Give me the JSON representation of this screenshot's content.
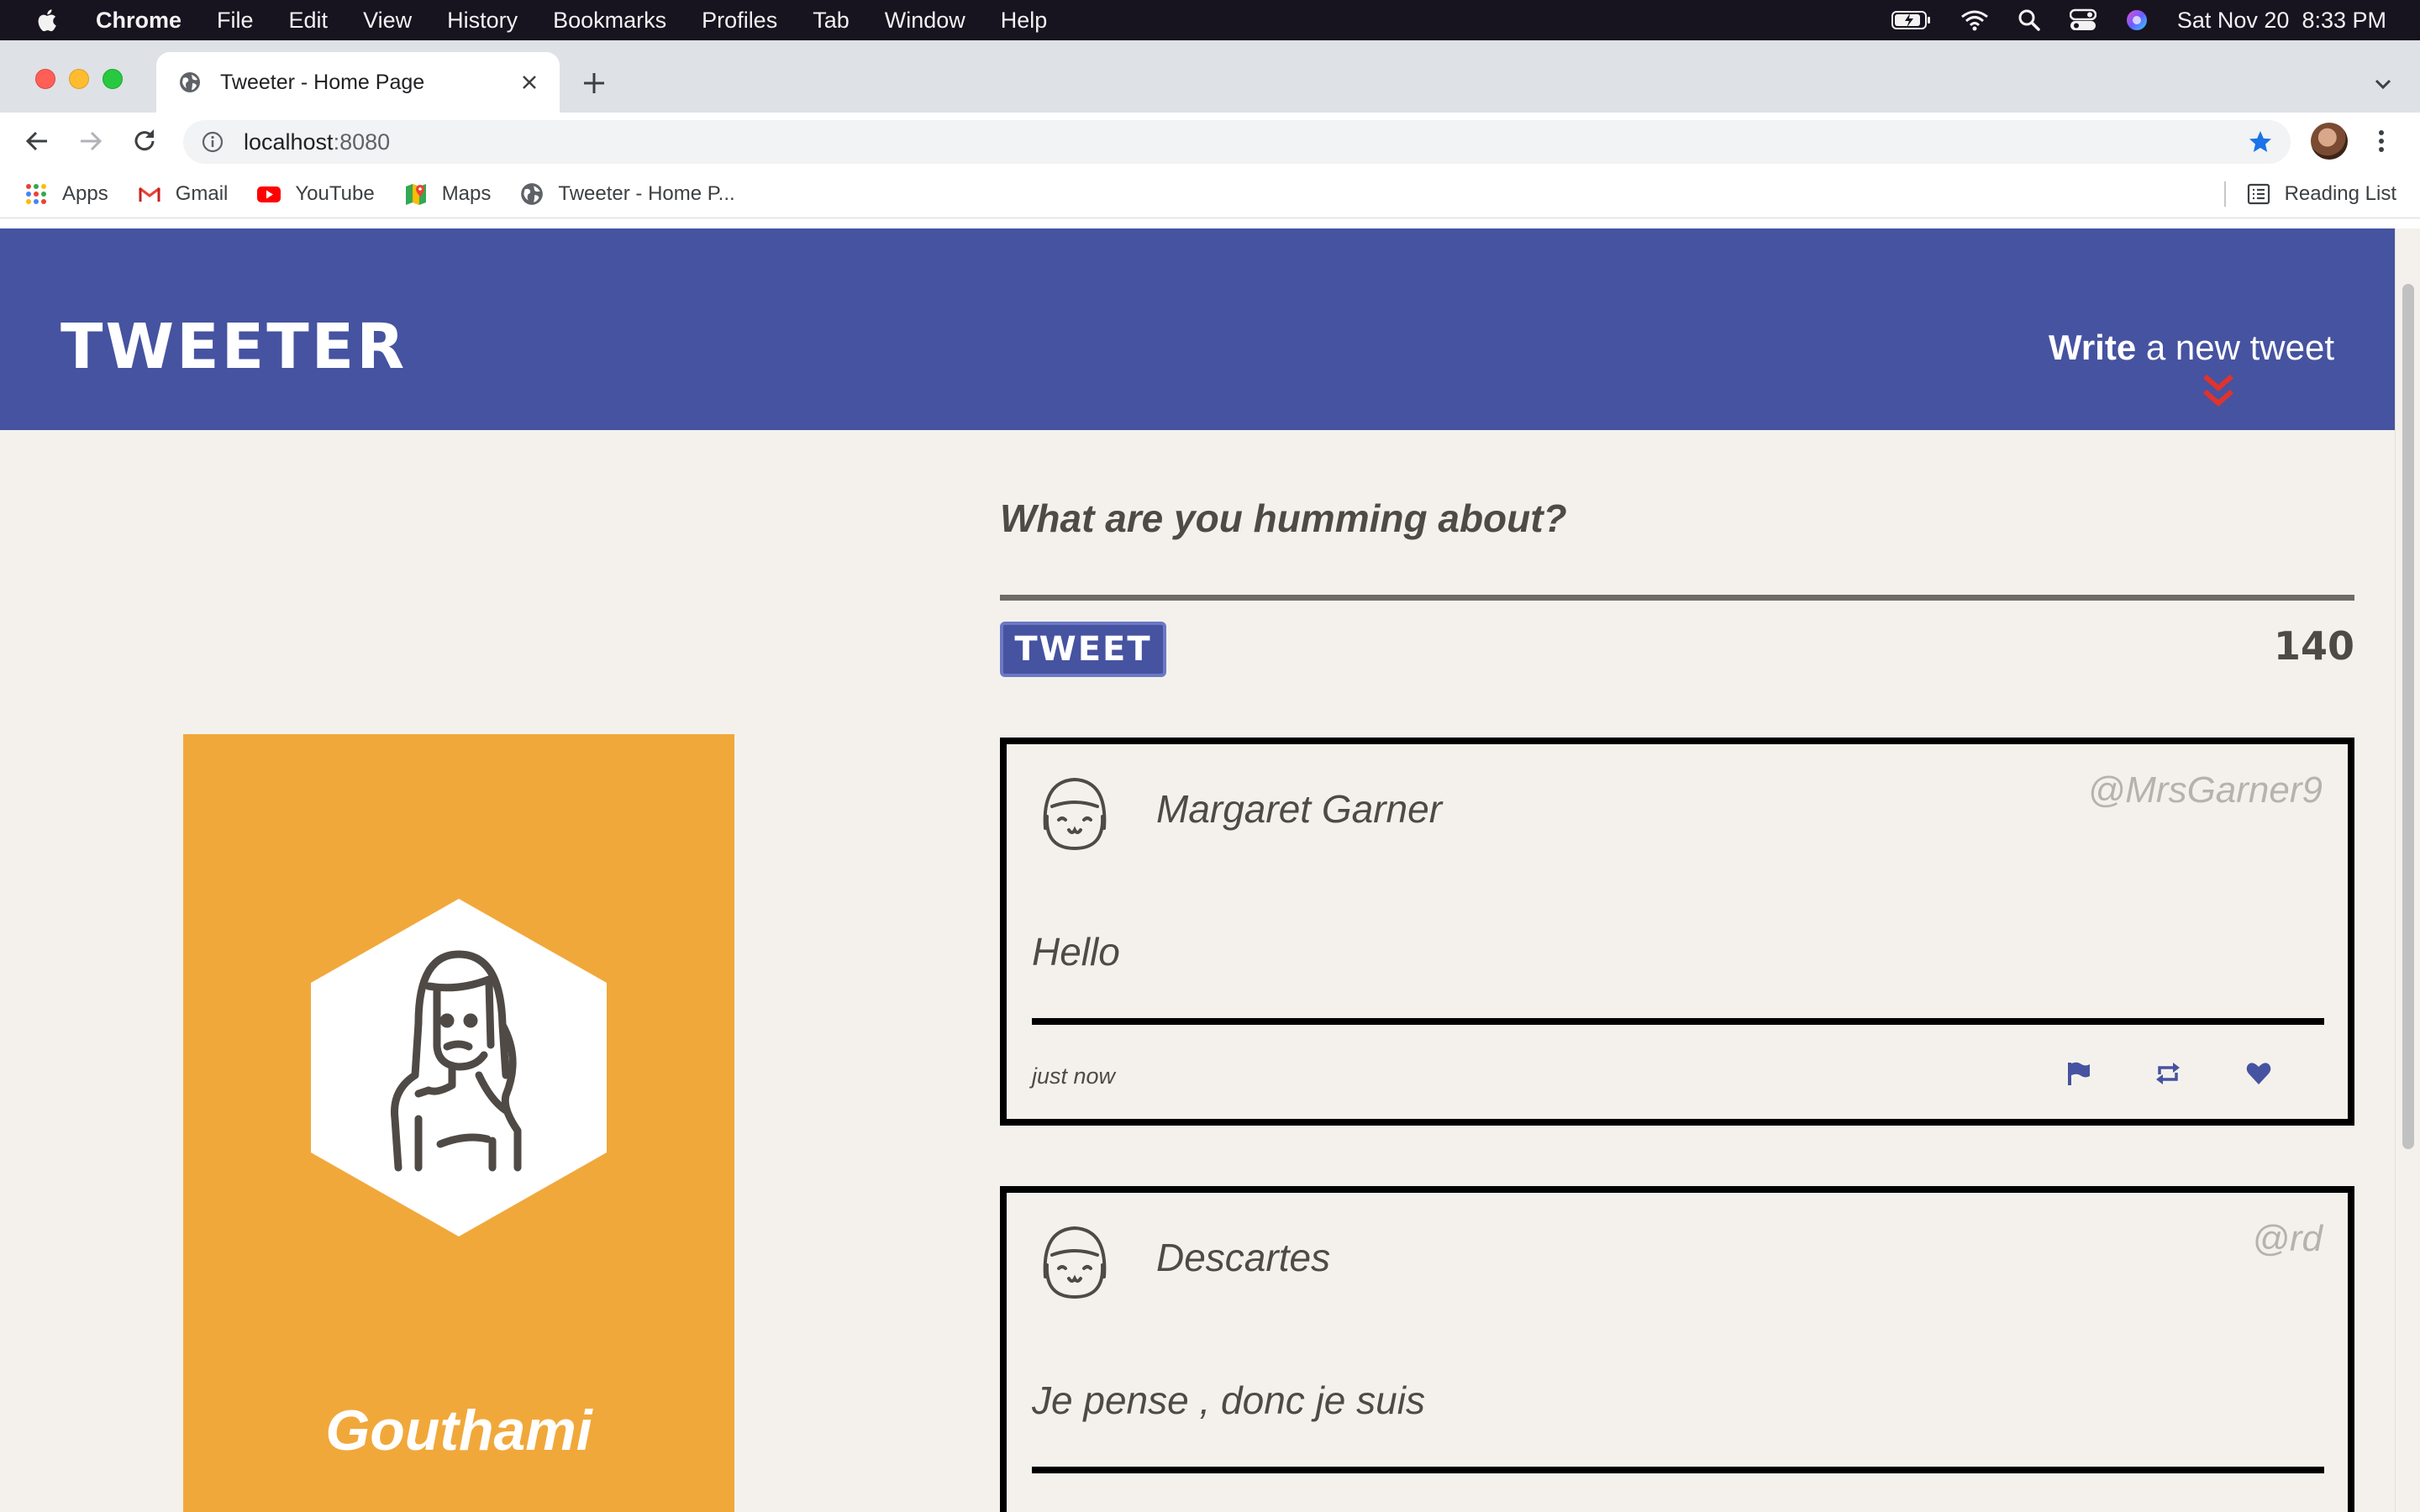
{
  "menubar": {
    "app": "Chrome",
    "items": [
      "File",
      "Edit",
      "View",
      "History",
      "Bookmarks",
      "Profiles",
      "Tab",
      "Window",
      "Help"
    ],
    "clock": "Sat Nov 20  8:33 PM",
    "icons": [
      "battery-icon",
      "wifi-icon",
      "spotlight-icon",
      "control-center-icon",
      "siri-icon"
    ]
  },
  "browser": {
    "tab_title": "Tweeter - Home Page",
    "url_host": "localhost",
    "url_port": ":8080",
    "bookmarks": [
      "Apps",
      "Gmail",
      "YouTube",
      "Maps",
      "Tweeter - Home P..."
    ],
    "reading_list": "Reading List"
  },
  "page": {
    "brand": "TWEETER",
    "write_bold": "Write",
    "write_rest": " a new tweet",
    "compose_prompt": "What are you humming about?",
    "tweet_button": "TWEET",
    "counter": "140",
    "profile_name": "Gouthami"
  },
  "tweets": [
    {
      "name": "Margaret Garner",
      "handle": "@MrsGarner9",
      "content": "Hello",
      "time": "just now"
    },
    {
      "name": "Descartes",
      "handle": "@rd",
      "content": "Je pense , donc je suis",
      "time": ""
    }
  ],
  "colors": {
    "nav": "#4653a0",
    "accent_chevron": "#e0332c",
    "profile_card": "#f1a83a",
    "page_background": "#f4f1ec",
    "action_icons": "#4653a0"
  }
}
